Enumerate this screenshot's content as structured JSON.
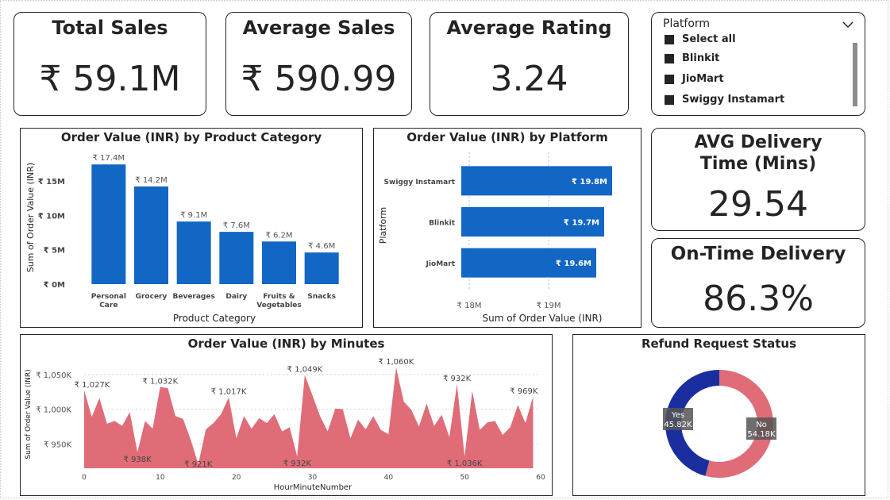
{
  "kpis": {
    "total_sales": {
      "title": "Total Sales",
      "value": "₹ 59.1M"
    },
    "average_sales": {
      "title": "Average Sales",
      "value": "₹ 590.99"
    },
    "average_rating": {
      "title": "Average Rating",
      "value": "3.24"
    },
    "avg_delivery_time": {
      "title": "AVG Delivery Time (Mins)",
      "value": "29.54"
    },
    "on_time_delivery": {
      "title": "On-Time Delivery",
      "value": "86.3%"
    }
  },
  "slicer": {
    "title": "Platform",
    "items": [
      "Select all",
      "Blinkit",
      "JioMart",
      "Swiggy Instamart"
    ]
  },
  "colors": {
    "bar_blue": "#1266C4",
    "area_red": "#E06C78",
    "donut_navy": "#1A2EA0",
    "donut_red": "#E06C78"
  },
  "chart_data": [
    {
      "type": "bar",
      "title": "Order Value (INR) by Product Category",
      "xlabel": "Product Category",
      "ylabel": "Sum of Order Value (INR)",
      "categories": [
        "Personal Care",
        "Grocery",
        "Beverages",
        "Dairy",
        "Fruits & Vegetables",
        "Snacks"
      ],
      "values": [
        17.4,
        14.2,
        9.1,
        7.6,
        6.2,
        4.6
      ],
      "data_labels": [
        "₹ 17.4M",
        "₹ 14.2M",
        "₹ 9.1M",
        "₹ 7.6M",
        "₹ 6.2M",
        "₹ 4.6M"
      ],
      "ylim": [
        0,
        18
      ],
      "yticks": [
        0,
        5,
        10,
        15
      ],
      "ytick_labels": [
        "₹ 0M",
        "₹ 5M",
        "₹ 10M",
        "₹ 15M"
      ]
    },
    {
      "type": "bar",
      "orientation": "horizontal",
      "title": "Order Value (INR) by Platform",
      "xlabel": "Sum of Order Value (INR)",
      "ylabel": "Platform",
      "categories": [
        "Swiggy Instamart",
        "Blinkit",
        "JioMart"
      ],
      "values": [
        19.8,
        19.7,
        19.6
      ],
      "data_labels": [
        "₹ 19.8M",
        "₹ 19.7M",
        "₹ 19.6M"
      ],
      "xlim": [
        17.9,
        20.1
      ],
      "xticks": [
        18,
        19
      ],
      "xtick_labels": [
        "₹ 18M",
        "₹ 19M"
      ]
    },
    {
      "type": "area",
      "title": "Order Value (INR) by Minutes",
      "xlabel": "HourMinuteNumber",
      "ylabel": "Sum of Order Value (INR)",
      "x": [
        0,
        1,
        2,
        3,
        4,
        5,
        6,
        7,
        8,
        9,
        10,
        11,
        12,
        13,
        14,
        15,
        16,
        17,
        18,
        19,
        20,
        21,
        22,
        23,
        24,
        25,
        26,
        27,
        28,
        29,
        30,
        31,
        32,
        33,
        34,
        35,
        36,
        37,
        38,
        39,
        40,
        41,
        42,
        43,
        44,
        45,
        46,
        47,
        48,
        49,
        50,
        51,
        52,
        53,
        54,
        55,
        56,
        57,
        58,
        59
      ],
      "values": [
        1027,
        989,
        1016,
        979,
        983,
        976,
        996,
        938,
        983,
        972,
        1032,
        1030,
        990,
        986,
        956,
        921,
        971,
        980,
        993,
        1017,
        958,
        990,
        972,
        987,
        980,
        993,
        968,
        974,
        932,
        1049,
        1020,
        990,
        968,
        1001,
        1000,
        958,
        985,
        971,
        990,
        970,
        964,
        1060,
        1011,
        999,
        975,
        1008,
        976,
        992,
        960,
        1036,
        932,
        1026,
        970,
        981,
        983,
        963,
        974,
        1006,
        980,
        1018,
        969
      ],
      "point_labels": {
        "0": "₹ 1,027K",
        "7": "₹ 938K",
        "10": "₹ 1,032K",
        "15": "₹ 921K",
        "19": "₹ 1,017K",
        "28": "₹ 932K",
        "29": "₹ 1,049K",
        "41": "₹ 1,060K",
        "49": "₹ 932K",
        "50": "₹ 1,036K",
        "59": "₹ 969K"
      },
      "ylim": [
        915,
        1068
      ],
      "yticks": [
        950,
        1000,
        1050
      ],
      "ytick_labels": [
        "₹ 950K",
        "₹ 1,000K",
        "₹ 1,050K"
      ],
      "xticks": [
        0,
        10,
        20,
        30,
        40,
        50,
        60
      ],
      "xtick_labels": [
        "0",
        "10",
        "20",
        "30",
        "40",
        "50",
        "60"
      ],
      "xlim": [
        0,
        60
      ]
    },
    {
      "type": "pie",
      "donut": true,
      "title": "Refund Request Status",
      "categories": [
        "Yes",
        "No"
      ],
      "values": [
        45.82,
        54.18
      ],
      "data_labels": [
        "45.82K",
        "54.18K"
      ]
    }
  ]
}
